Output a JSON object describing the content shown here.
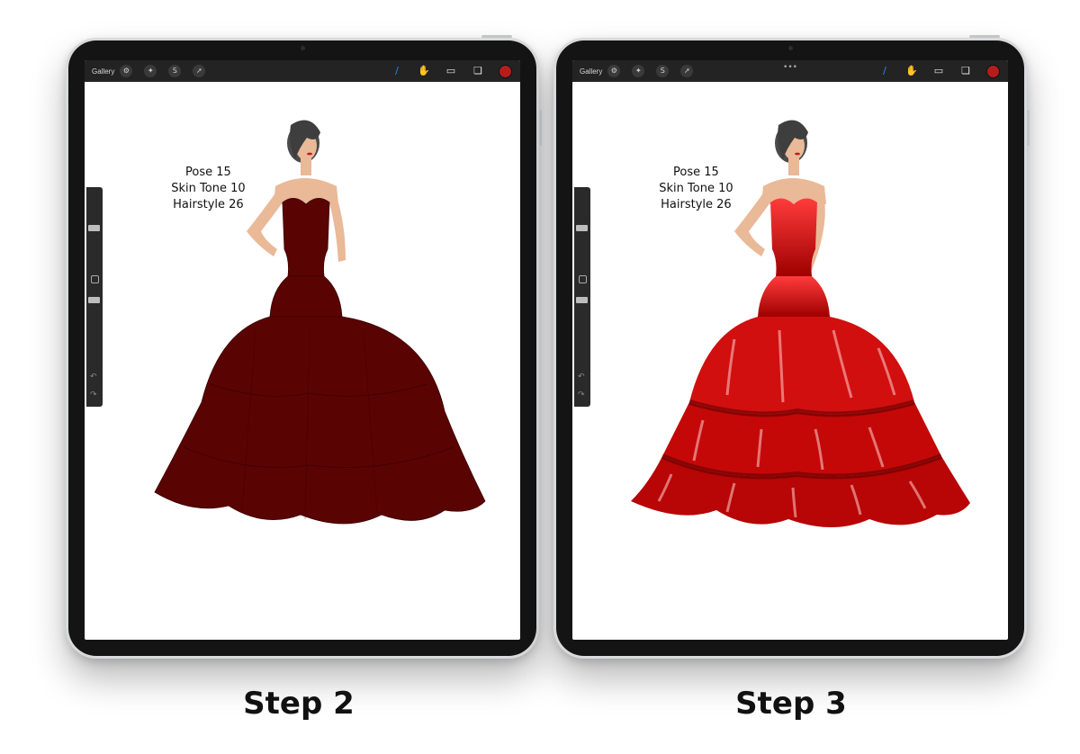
{
  "panels": [
    {
      "app": {
        "gallery_label": "Gallery"
      },
      "tools_left": [
        "wrench-icon",
        "magic-wand-icon",
        "selection-s-icon",
        "transform-arrow-icon"
      ],
      "tools_right": [
        "brush-icon",
        "smudge-icon",
        "eraser-icon",
        "layers-icon"
      ],
      "current_color": "#b51d1d",
      "caption": {
        "pose": "Pose 15",
        "skin_tone": "Skin Tone 10",
        "hairstyle": "Hairstyle 26"
      },
      "step_label": "Step 2",
      "dress_color": "#5a0303",
      "show_dots": false
    },
    {
      "app": {
        "gallery_label": "Gallery"
      },
      "tools_left": [
        "wrench-icon",
        "magic-wand-icon",
        "selection-s-icon",
        "transform-arrow-icon"
      ],
      "tools_right": [
        "brush-icon",
        "smudge-icon",
        "eraser-icon",
        "layers-icon"
      ],
      "current_color": "#b51d1d",
      "caption": {
        "pose": "Pose 15",
        "skin_tone": "Skin Tone 10",
        "hairstyle": "Hairstyle 26"
      },
      "step_label": "Step 3",
      "dress_color": "#d10f0f",
      "show_dots": true
    }
  ],
  "colors": {
    "skin": "#e9b998",
    "hair": "#4a4a4a",
    "lips": "#c41a1a"
  }
}
